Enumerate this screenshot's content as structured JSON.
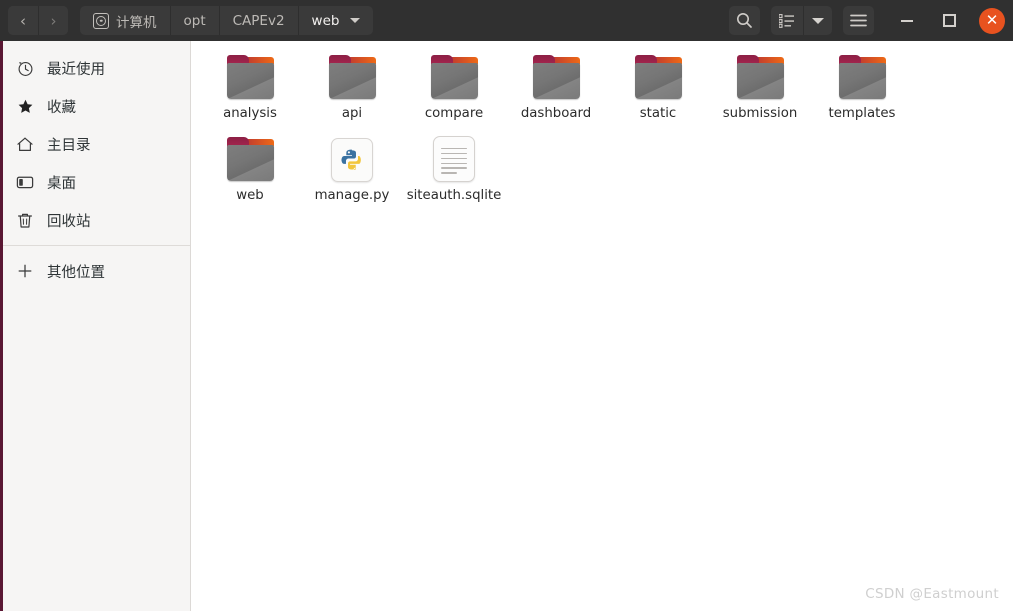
{
  "window": {
    "titlebar": {
      "back_label": "‹",
      "forward_label": "›",
      "search_icon": "search-icon",
      "list_view_icon": "list-view-icon",
      "view_dropdown_icon": "chevron-down-icon",
      "menu_icon": "hamburger-menu-icon",
      "minimize_label": "",
      "maximize_label": "",
      "close_label": "✕"
    },
    "breadcrumbs": [
      {
        "label": "计算机",
        "icon": "disk-icon",
        "active": false,
        "has_dropdown": false
      },
      {
        "label": "opt",
        "icon": "",
        "active": false,
        "has_dropdown": false
      },
      {
        "label": "CAPEv2",
        "icon": "",
        "active": false,
        "has_dropdown": false
      },
      {
        "label": "web",
        "icon": "",
        "active": true,
        "has_dropdown": true
      }
    ]
  },
  "sidebar": {
    "items": [
      {
        "label": "最近使用",
        "icon": "clock-icon"
      },
      {
        "label": "收藏",
        "icon": "star-icon"
      },
      {
        "label": "主目录",
        "icon": "home-icon"
      },
      {
        "label": "桌面",
        "icon": "desktop-icon"
      },
      {
        "label": "回收站",
        "icon": "trash-icon"
      }
    ],
    "other": {
      "label": "其他位置",
      "icon": "plus-icon"
    }
  },
  "files": [
    {
      "name": "analysis",
      "type": "folder"
    },
    {
      "name": "api",
      "type": "folder"
    },
    {
      "name": "compare",
      "type": "folder"
    },
    {
      "name": "dashboard",
      "type": "folder"
    },
    {
      "name": "static",
      "type": "folder"
    },
    {
      "name": "submission",
      "type": "folder"
    },
    {
      "name": "templates",
      "type": "folder"
    },
    {
      "name": "web",
      "type": "folder"
    },
    {
      "name": "manage.py",
      "type": "python"
    },
    {
      "name": "siteauth.sqlite",
      "type": "document"
    }
  ],
  "watermark": "CSDN @Eastmount",
  "colors": {
    "headerbar_bg": "#303030",
    "sidebar_bg": "#f6f5f4",
    "sidebar_accent": "#5a1733",
    "close_button": "#e8521f",
    "folder_body": "#787878",
    "folder_tab": "#9c2249",
    "folder_highlight": "#ee6a16",
    "main_bg": "#ffffff"
  }
}
